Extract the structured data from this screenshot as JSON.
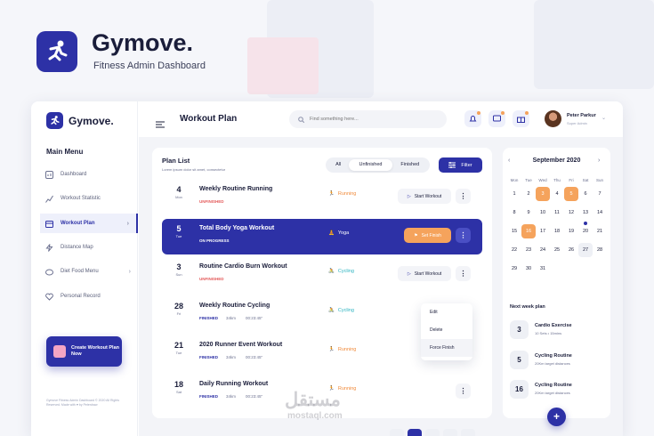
{
  "brand": {
    "name": "Gymove.",
    "tagline": "Fitness Admin Dashboard",
    "app_name": "Gymove."
  },
  "sidebar": {
    "menu_title": "Main Menu",
    "items": [
      {
        "label": "Dashboard",
        "icon": "dashboard-icon"
      },
      {
        "label": "Workout Statistic",
        "icon": "chart-icon"
      },
      {
        "label": "Workout Plan",
        "icon": "calendar-icon",
        "active": true
      },
      {
        "label": "Distance Map",
        "icon": "lightning-icon"
      },
      {
        "label": "Diet Food Menu",
        "icon": "food-icon"
      },
      {
        "label": "Personal Record",
        "icon": "heart-icon"
      }
    ],
    "create_card": "Create Workout Plan Now",
    "footer": "Gymove Fitness Admin Dashboard © 2020 All Rights Reserved. Made with ♥ by Peterdraw"
  },
  "topbar": {
    "title": "Workout Plan",
    "search_placeholder": "Find something here...",
    "user_name": "Peter Parkur",
    "user_role": "Super Admin"
  },
  "plan": {
    "title": "Plan List",
    "subtitle": "Lorem ipsum dolor sit amet, consectetur",
    "tabs": [
      "All",
      "Unfinished",
      "Finished"
    ],
    "active_tab": "Unfinished",
    "filter_label": "Filter",
    "rows": [
      {
        "day": "4",
        "weekday": "Mon",
        "title": "Weekly Routine Running",
        "status": "UNFINISHED",
        "type": "Running",
        "action": "Start Workout"
      },
      {
        "day": "5",
        "weekday": "Tue",
        "title": "Total Body Yoga Workout",
        "status": "ON PROGRESS",
        "type": "Yoga",
        "action": "Set Finish"
      },
      {
        "day": "3",
        "weekday": "Sun",
        "title": "Routine Cardio Burn Workout",
        "status": "UNFINISHED",
        "type": "Cycling",
        "action": "Start Workout"
      },
      {
        "day": "28",
        "weekday": "Fri",
        "title": "Weekly Routine Cycling",
        "status": "FINISHED",
        "distance": "34km",
        "time": "00:23:45\"",
        "type": "Cycling"
      },
      {
        "day": "21",
        "weekday": "Tue",
        "title": "2020 Runner Event Workout",
        "status": "FINISHED",
        "distance": "34km",
        "time": "00:23:45\"",
        "type": "Running"
      },
      {
        "day": "18",
        "weekday": "Sat",
        "title": "Daily Running Workout",
        "status": "FINISHED",
        "distance": "34km",
        "time": "00:23:45\"",
        "type": "Running"
      }
    ],
    "context_menu": [
      "Edit",
      "Delete",
      "Force Finish"
    ]
  },
  "calendar": {
    "month": "September 2020",
    "weekdays": [
      "Mon",
      "Tue",
      "Wed",
      "Thu",
      "Fri",
      "Sat",
      "Sun"
    ],
    "weeks": [
      [
        "1",
        "2",
        "3",
        "4",
        "5",
        "6",
        "7"
      ],
      [
        "8",
        "9",
        "10",
        "11",
        "12",
        "13",
        "14"
      ],
      [
        "15",
        "16",
        "17",
        "18",
        "19",
        "20",
        "21"
      ],
      [
        "22",
        "23",
        "24",
        "25",
        "26",
        "27",
        "28"
      ],
      [
        "29",
        "30",
        "31",
        "",
        "",
        "",
        ""
      ]
    ],
    "highlighted": [
      "3",
      "5",
      "16"
    ],
    "today": "27",
    "dot": "20"
  },
  "next_week": {
    "title": "Next week plan",
    "items": [
      {
        "num": "3",
        "name": "Cardio Exercise",
        "sub": "10 Sets  •  15mins"
      },
      {
        "num": "5",
        "name": "Cycling Routine",
        "sub": "20Km target distances"
      },
      {
        "num": "16",
        "name": "Cycling Routine",
        "sub": "20Km target distances"
      }
    ]
  },
  "watermark": {
    "arabic": "مستقل",
    "latin": "mostaql.com"
  },
  "colors": {
    "primary": "#2d31a6",
    "accent": "#f5a35c",
    "danger": "#e45a5a",
    "cycling": "#2bb3c0"
  }
}
